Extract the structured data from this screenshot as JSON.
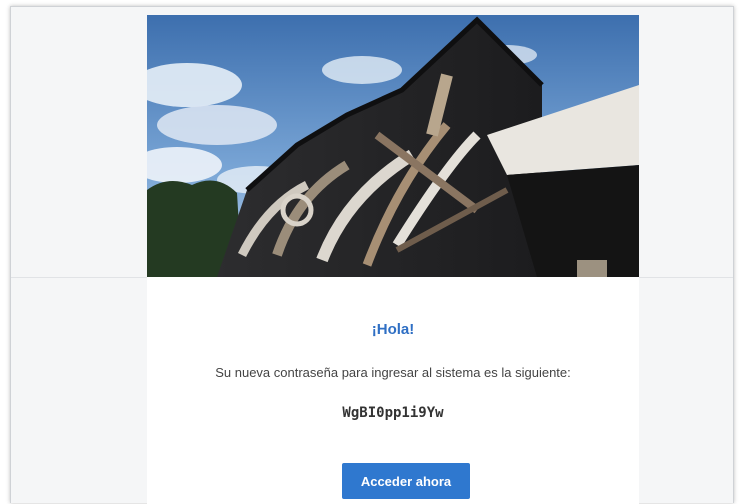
{
  "email": {
    "greeting": "¡Hola!",
    "message": "Su nueva contraseña para ingresar al sistema es la siguiente:",
    "password": "WgBI0pp1i9Yw",
    "cta_label": "Acceder ahora"
  },
  "colors": {
    "accent": "#2f78cf",
    "greeting": "#2f6fc4"
  },
  "hero": {
    "image": "building-with-mural-photo"
  }
}
